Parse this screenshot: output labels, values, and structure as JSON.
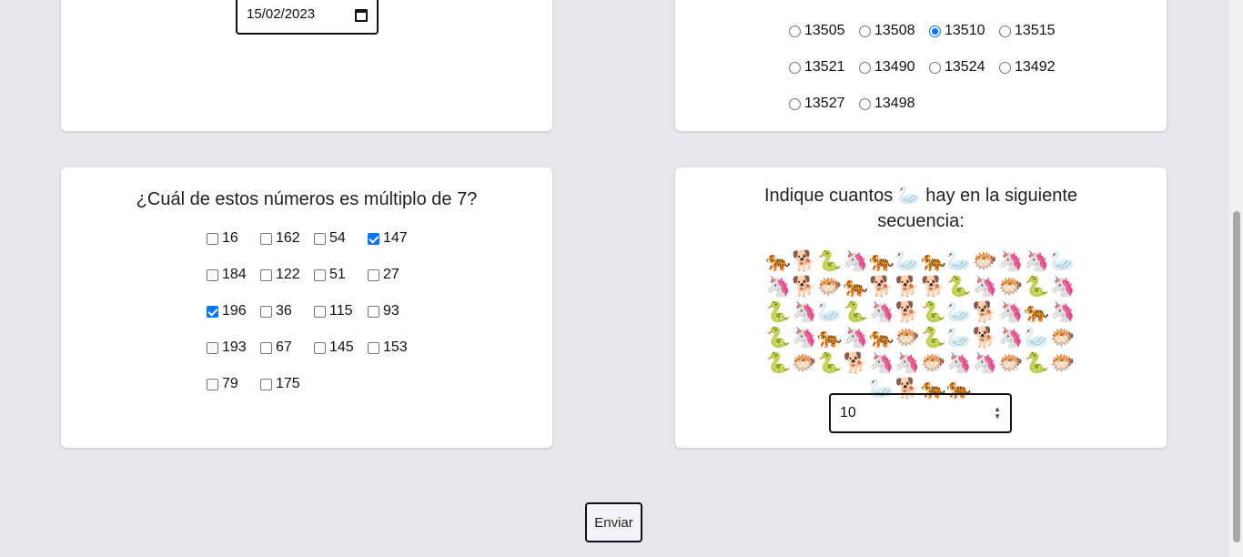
{
  "date_card": {
    "value": "15/02/2023"
  },
  "radio_options": [
    {
      "label": "13505",
      "checked": false
    },
    {
      "label": "13508",
      "checked": false
    },
    {
      "label": "13510",
      "checked": true
    },
    {
      "label": "13515",
      "checked": false
    },
    {
      "label": "13521",
      "checked": false
    },
    {
      "label": "13490",
      "checked": false
    },
    {
      "label": "13524",
      "checked": false
    },
    {
      "label": "13492",
      "checked": false
    },
    {
      "label": "13527",
      "checked": false
    },
    {
      "label": "13498",
      "checked": false
    }
  ],
  "multiple_card": {
    "question": "¿Cuál de estos números es múltiplo de 7?",
    "options": [
      {
        "label": "16",
        "checked": false
      },
      {
        "label": "162",
        "checked": false
      },
      {
        "label": "54",
        "checked": false
      },
      {
        "label": "147",
        "checked": true
      },
      {
        "label": "184",
        "checked": false
      },
      {
        "label": "122",
        "checked": false
      },
      {
        "label": "51",
        "checked": false
      },
      {
        "label": "27",
        "checked": false
      },
      {
        "label": "196",
        "checked": true
      },
      {
        "label": "36",
        "checked": false
      },
      {
        "label": "115",
        "checked": false
      },
      {
        "label": "93",
        "checked": false
      },
      {
        "label": "193",
        "checked": false
      },
      {
        "label": "67",
        "checked": false
      },
      {
        "label": "145",
        "checked": false
      },
      {
        "label": "153",
        "checked": false
      },
      {
        "label": "79",
        "checked": false
      },
      {
        "label": "175",
        "checked": false
      }
    ]
  },
  "count_card": {
    "question": "Indique cuantos 🦢 hay en la siguiente secuencia:",
    "sequence": "🐅🐕🐍🦄🐅🦢🐅🦢🐡🦄🦄🦢🦄🐕🐡🐅🐕🐕🐕🐍🦄🐡🐍🦄🐍🦄🦢🐍🦄🐕🐍🦢🐕🦄🐅🦄🐍🦄🐅🦄🐅🐡🐍🦢🐕🦄🦢🐡🐍🐡🐍🐕🦄🦄🐡🦄🦄🐡🐍🐡🦢🐕🐅🐅",
    "answer": "10"
  },
  "submit_label": "Enviar"
}
